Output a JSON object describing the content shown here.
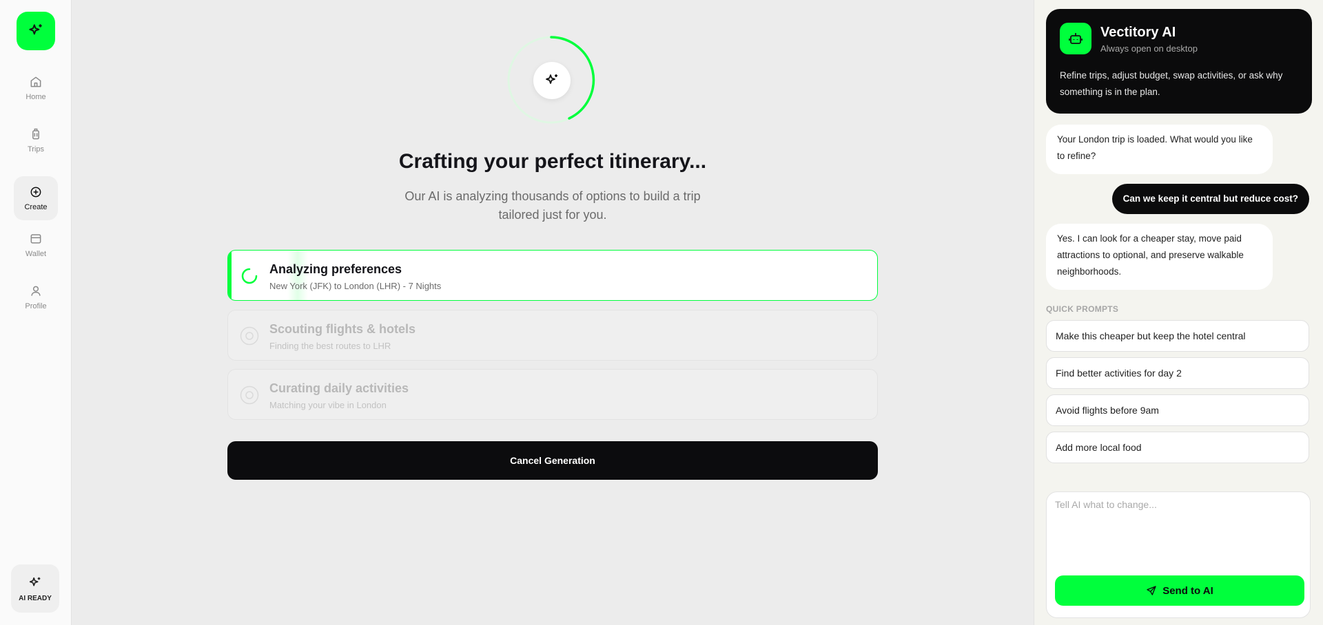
{
  "sidebar": {
    "logo_icon": "sparkles-icon",
    "nav": [
      {
        "label": "Home",
        "icon": "home-icon",
        "active": false
      },
      {
        "label": "Trips",
        "icon": "luggage-icon",
        "active": false
      },
      {
        "label": "Create",
        "icon": "plus-circle-icon",
        "active": true
      },
      {
        "label": "Wallet",
        "icon": "wallet-icon",
        "active": false
      },
      {
        "label": "Profile",
        "icon": "user-icon",
        "active": false
      }
    ],
    "ai_ready_label": "AI READY"
  },
  "main": {
    "title": "Crafting your perfect itinerary...",
    "subtitle": "Our AI is analyzing thousands of options to build a trip tailored just for you.",
    "steps": [
      {
        "title": "Analyzing preferences",
        "subtitle": "New York (JFK) to London (LHR) - 7 Nights",
        "status": "active"
      },
      {
        "title": "Scouting flights & hotels",
        "subtitle": "Finding the best routes to LHR",
        "status": "pending"
      },
      {
        "title": "Curating daily activities",
        "subtitle": "Matching your vibe in London",
        "status": "pending"
      }
    ],
    "cancel_label": "Cancel Generation"
  },
  "assistant": {
    "name": "Vectitory AI",
    "status": "Always open on desktop",
    "description": "Refine trips, adjust budget, swap activities, or ask why something is in the plan.",
    "messages": [
      {
        "role": "ai",
        "text": "Your London trip is loaded. What would you like to refine?"
      },
      {
        "role": "user",
        "text": "Can we keep it central but reduce cost?"
      },
      {
        "role": "ai",
        "text": "Yes. I can look for a cheaper stay, move paid attractions to optional, and preserve walkable neighborhoods."
      }
    ],
    "quick_prompts_label": "QUICK PROMPTS",
    "quick_prompts": [
      "Make this cheaper but keep the hotel central",
      "Find better activities for day 2",
      "Avoid flights before 9am",
      "Add more local food"
    ],
    "input_placeholder": "Tell AI what to change...",
    "send_label": "Send to AI"
  },
  "colors": {
    "accent": "#00ff3c",
    "dark": "#0b0b0c"
  }
}
